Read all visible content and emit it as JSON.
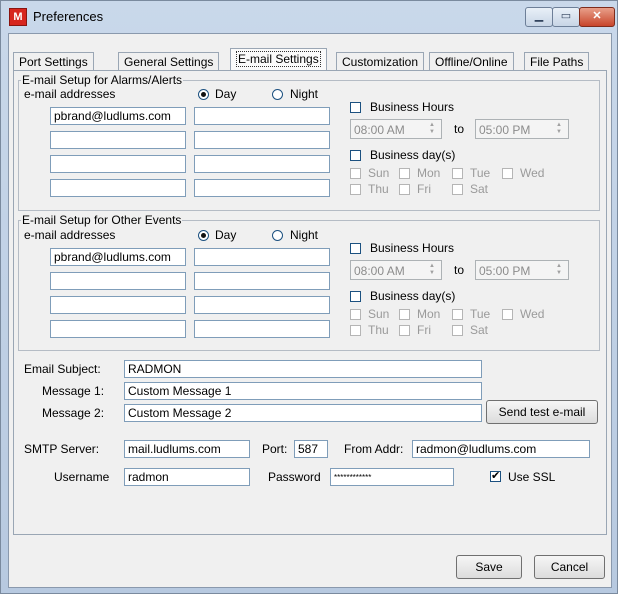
{
  "window": {
    "title": "Preferences",
    "app_icon": "M",
    "minimize": "▁",
    "maximize": "▭",
    "close": "✕"
  },
  "tabs": [
    "Port Settings",
    "General Settings",
    "E-mail Settings",
    "Customization",
    "Offline/Online",
    "File Paths"
  ],
  "alarms": {
    "legend": "E-mail Setup for Alarms/Alerts",
    "email_header": "e-mail addresses",
    "day_label": "Day",
    "night_label": "Night",
    "day_emails": [
      "pbrand@ludlums.com",
      "",
      "",
      ""
    ],
    "night_emails": [
      "",
      "",
      "",
      ""
    ],
    "business_hours": "Business Hours",
    "from_time": "08:00 AM",
    "to_label": "to",
    "to_time": "05:00 PM",
    "business_days": "Business day(s)",
    "days": [
      "Sun",
      "Mon",
      "Tue",
      "Wed",
      "Thu",
      "Fri",
      "Sat"
    ]
  },
  "other": {
    "legend": "E-mail Setup for Other Events",
    "email_header": "e-mail addresses",
    "day_label": "Day",
    "night_label": "Night",
    "day_emails": [
      "pbrand@ludlums.com",
      "",
      "",
      ""
    ],
    "night_emails": [
      "",
      "",
      "",
      ""
    ],
    "business_hours": "Business Hours",
    "from_time": "08:00 AM",
    "to_label": "to",
    "to_time": "05:00 PM",
    "business_days": "Business day(s)",
    "days": [
      "Sun",
      "Mon",
      "Tue",
      "Wed",
      "Thu",
      "Fri",
      "Sat"
    ]
  },
  "email": {
    "subject_label": "Email Subject:",
    "subject": "RADMON",
    "msg1_label": "Message 1:",
    "msg1": "Custom Message 1",
    "msg2_label": "Message 2:",
    "msg2": "Custom Message 2",
    "send_test": "Send test e-mail"
  },
  "smtp": {
    "server_label": "SMTP Server:",
    "server": "mail.ludlums.com",
    "port_label": "Port:",
    "port": "587",
    "from_label": "From Addr:",
    "from": "radmon@ludlums.com",
    "username_label": "Username",
    "username": "radmon",
    "password_label": "Password",
    "password": "************",
    "ssl_label": "Use SSL"
  },
  "footer": {
    "save": "Save",
    "cancel": "Cancel"
  }
}
